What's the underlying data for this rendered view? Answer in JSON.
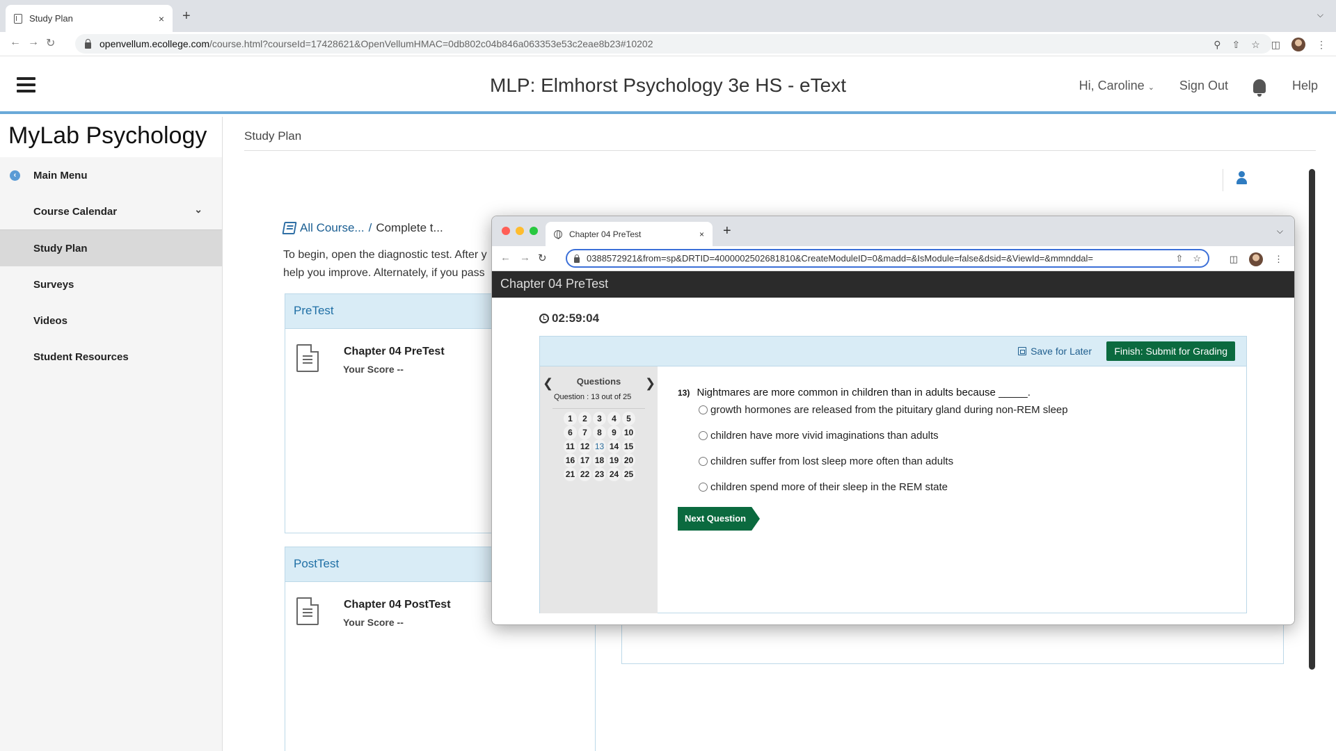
{
  "browser": {
    "tab_title": "Study Plan",
    "tab_close": "×",
    "new_tab": "+",
    "url_host": "openvellum.ecollege.com",
    "url_path": "/course.html?courseId=17428621&OpenVellumHMAC=0db802c04b846a063353e53c2eae8b23#10202"
  },
  "header": {
    "title": "MLP: Elmhorst Psychology 3e HS - eText",
    "greeting": "Hi, Caroline",
    "sign_out": "Sign Out",
    "help": "Help"
  },
  "sidebar": {
    "brand": "MyLab Psychology",
    "items": [
      {
        "label": "Main Menu"
      },
      {
        "label": "Course Calendar"
      },
      {
        "label": "Study Plan"
      },
      {
        "label": "Surveys"
      },
      {
        "label": "Videos"
      },
      {
        "label": "Student Resources"
      }
    ]
  },
  "main": {
    "page_title": "Study Plan",
    "breadcrumb_link": "All Course...",
    "breadcrumb_sep": "/",
    "breadcrumb_current": "Complete t...",
    "intro_line1": "To begin, open the diagnostic test. After y",
    "intro_line2": "help you improve. Alternately, if you pass",
    "pretest": {
      "heading": "PreTest",
      "title": "Chapter 04 PreTest",
      "score": "Your Score --"
    },
    "posttest": {
      "heading": "PostTest",
      "title": "Chapter 04 PostTest",
      "score": "Your Score --"
    }
  },
  "popup": {
    "tab_title": "Chapter 04 PreTest",
    "tab_close": "×",
    "new_tab": "+",
    "url": "0388572921&from=sp&DRTID=4000002502681810&CreateModuleID=0&madd=&IsModule=false&dsid=&ViewId=&mmnddal=",
    "window_title": "Chapter 04 PreTest",
    "timer": "02:59:04",
    "save_later": "Save for Later",
    "finish": "Finish: Submit for Grading",
    "nav": {
      "label": "Questions",
      "count": "Question : 13 out of  25",
      "numbers": [
        "1",
        "2",
        "3",
        "4",
        "5",
        "6",
        "7",
        "8",
        "9",
        "10",
        "11",
        "12",
        "13",
        "14",
        "15",
        "16",
        "17",
        "18",
        "19",
        "20",
        "21",
        "22",
        "23",
        "24",
        "25"
      ],
      "current": "13"
    },
    "question": {
      "number": "13)",
      "text": "Nightmares are more common in children than in adults because _____.",
      "answers": [
        "growth hormones are released from the pituitary gland during non-REM sleep",
        "children have more vivid imaginations than adults",
        "children suffer from lost sleep more often than adults",
        "children spend more of their sleep in the REM state"
      ]
    },
    "next_button": "Next Question"
  }
}
